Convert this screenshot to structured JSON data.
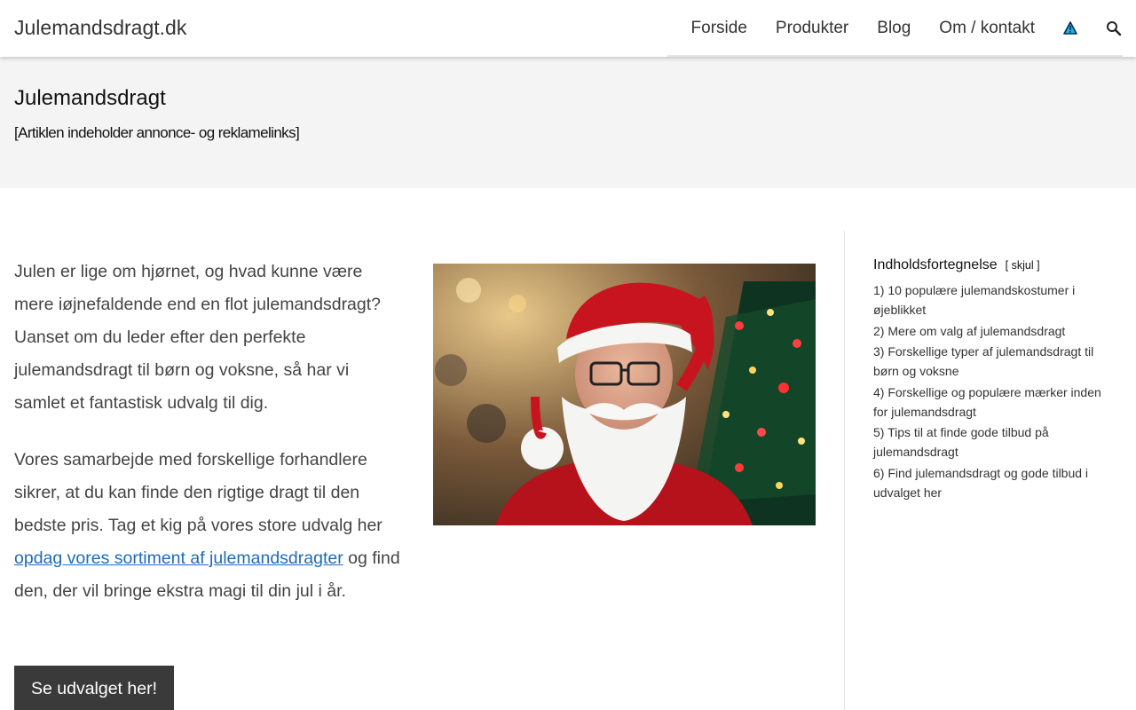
{
  "header": {
    "logo": "Julemandsdragt.dk",
    "nav": [
      "Forside",
      "Produkter",
      "Blog",
      "Om / kontakt"
    ],
    "icons": [
      "warning-icon",
      "search-icon"
    ]
  },
  "banner": {
    "title": "Julemandsdragt",
    "note": "[Artiklen indeholder annonce- og reklamelinks]"
  },
  "article": {
    "p1": "Julen er lige om hjørnet, og hvad kunne være mere iøjnefaldende end en flot julemandsdragt? Uanset om du leder efter den perfekte julemandsdragt til børn og voksne, så har vi samlet et fantastisk udvalg til dig.",
    "p2_before": "Vores samarbejde med forskellige forhandlere sikrer, at du kan finde den rigtige dragt til den bedste pris. Tag et kig på vores store udvalg her ",
    "p2_link": "opdag vores sortiment af julemandsdragter",
    "p2_after": " og find den, der vil bringe ekstra magi til din jul i år.",
    "cta": "Se udvalget her!"
  },
  "toc": {
    "title": "Indholdsfortegnelse",
    "toggle": "[ skjul ]",
    "items": [
      "1) 10 populære julemandskostumer i øjeblikket",
      "2) Mere om valg af julemandsdragt",
      "3) Forskellige typer af julemandsdragt til børn og voksne",
      "4) Forskellige og populære mærker inden for julemandsdragt",
      "5) Tips til at finde gode tilbud på julemandsdragt",
      "6) Find julemandsdragt og gode tilbud i udvalget her"
    ]
  },
  "colors": {
    "link": "#1e6bb8",
    "cta_bg": "#3a3a3a",
    "banner_bg": "#f4f4f4"
  }
}
